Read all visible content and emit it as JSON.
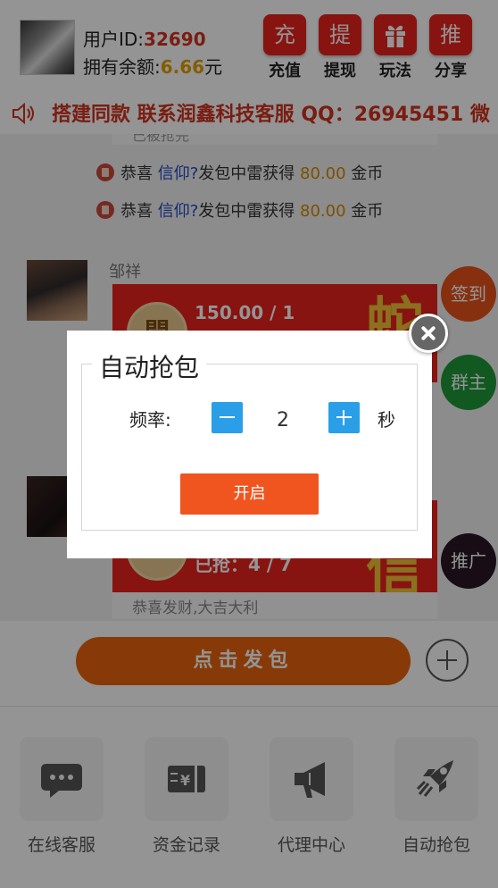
{
  "header": {
    "uid_label": "用户ID:",
    "uid_value": "32690",
    "balance_label": "拥有余额:",
    "balance_value": "6.66",
    "balance_unit": "元",
    "buttons": [
      {
        "glyph": "充",
        "label": "充值",
        "icon": "recharge-icon"
      },
      {
        "glyph": "提",
        "label": "提现",
        "icon": "withdraw-icon"
      },
      {
        "glyph": "",
        "label": "玩法",
        "icon": "gift-icon"
      },
      {
        "glyph": "推",
        "label": "分享",
        "icon": "share-icon"
      }
    ]
  },
  "marquee": {
    "icon": "speaker-icon",
    "text": "搭建同款 联系润鑫科技客服 QQ：26945451 微"
  },
  "chat": {
    "top_stub_text": "已被抢完",
    "system_messages": [
      {
        "prefix": "恭喜",
        "user": "信仰?",
        "middle": "发包中雷获得",
        "amount": "80.00",
        "suffix": "金币"
      },
      {
        "prefix": "恭喜",
        "user": "信仰?",
        "middle": "发包中雷获得",
        "amount": "80.00",
        "suffix": "金币"
      }
    ],
    "messages": [
      {
        "sender": "邹祥",
        "amount_text": "150.00 / 1",
        "coin_glyph": "開"
      },
      {
        "sender": "",
        "amount_text": "已抢：4 / 7",
        "coin_glyph": "",
        "footer": "恭喜发财,大吉大利"
      }
    ]
  },
  "side_buttons": [
    {
      "label": "签到",
      "color": "#e8541c"
    },
    {
      "label": "群主",
      "color": "#1e9a3a"
    },
    {
      "label": "推广",
      "color": "#2a1525"
    }
  ],
  "compose": {
    "send_label": "点击发包",
    "plus_icon": "plus-circle-icon"
  },
  "menu": [
    {
      "label": "在线客服",
      "icon": "chat-bubble-icon"
    },
    {
      "label": "资金记录",
      "icon": "money-record-icon"
    },
    {
      "label": "代理中心",
      "icon": "megaphone-icon"
    },
    {
      "label": "自动抢包",
      "icon": "rocket-icon"
    }
  ],
  "dialog": {
    "title": "自动抢包",
    "frequency_label": "频率:",
    "frequency_value": "2",
    "unit": "秒",
    "start_label": "开启",
    "close_icon": "close-icon"
  },
  "colors": {
    "brand_red": "#e8231c",
    "accent_orange": "#e8650f",
    "stepper_blue": "#2a9fe8",
    "start_orange": "#f0541f"
  }
}
